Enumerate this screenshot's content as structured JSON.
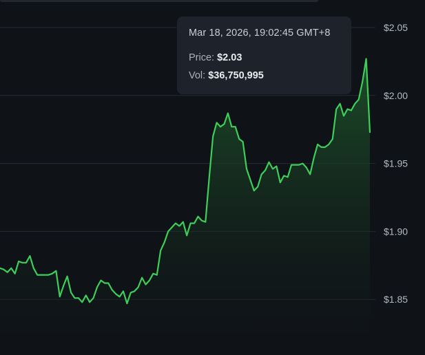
{
  "tooltip": {
    "timestamp": "Mar 18, 2026, 19:02:45 GMT+8",
    "price_label": "Price:",
    "price_value": "$2.03",
    "vol_label": "Vol:",
    "vol_value": "$36,750,995"
  },
  "colors": {
    "background": "#0f1217",
    "line": "#3ecf5a",
    "fill_top": "#1f5a2c",
    "grid": "#262b33",
    "crosshair": "#2fa84c"
  },
  "chart_data": {
    "type": "area",
    "title": "",
    "xlabel": "",
    "ylabel": "",
    "ylim": [
      1.81,
      2.06
    ],
    "yticks": [
      {
        "value": 2.05,
        "label": "$2.05"
      },
      {
        "value": 2.0,
        "label": "$2.00"
      },
      {
        "value": 1.95,
        "label": "$1.95"
      },
      {
        "value": 1.9,
        "label": "$1.90"
      },
      {
        "value": 1.85,
        "label": "$1.85"
      }
    ],
    "grid": "horizontal",
    "hover_index": 135,
    "series": [
      {
        "values": [
          1.873,
          1.872,
          1.87,
          1.873,
          1.869,
          1.878,
          1.877,
          1.877,
          1.882,
          1.873,
          1.868,
          1.868,
          1.868,
          1.868,
          1.869,
          1.871,
          1.852,
          1.86,
          1.867,
          1.855,
          1.851,
          1.851,
          1.848,
          1.853,
          1.848,
          1.851,
          1.859,
          1.864,
          1.862,
          1.862,
          1.857,
          1.854,
          1.852,
          1.856,
          1.847,
          1.855,
          1.856,
          1.859,
          1.866,
          1.861,
          1.864,
          1.869,
          1.868,
          1.886,
          1.892,
          1.9,
          1.903,
          1.906,
          1.904,
          1.907,
          1.897,
          1.906,
          1.906,
          1.911,
          1.908,
          1.907,
          1.94,
          1.97,
          1.98,
          1.977,
          1.979,
          1.987,
          1.977,
          1.977,
          1.968,
          1.966,
          1.946,
          1.938,
          1.93,
          1.933,
          1.942,
          1.945,
          1.951,
          1.946,
          1.948,
          1.936,
          1.941,
          1.94,
          1.949,
          1.949,
          1.949,
          1.95,
          1.947,
          1.942,
          1.954,
          1.964,
          1.962,
          1.962,
          1.964,
          1.968,
          1.99,
          1.994,
          1.985,
          1.99,
          1.989,
          1.994,
          1.997,
          2.01,
          2.027,
          1.973
        ]
      }
    ]
  }
}
